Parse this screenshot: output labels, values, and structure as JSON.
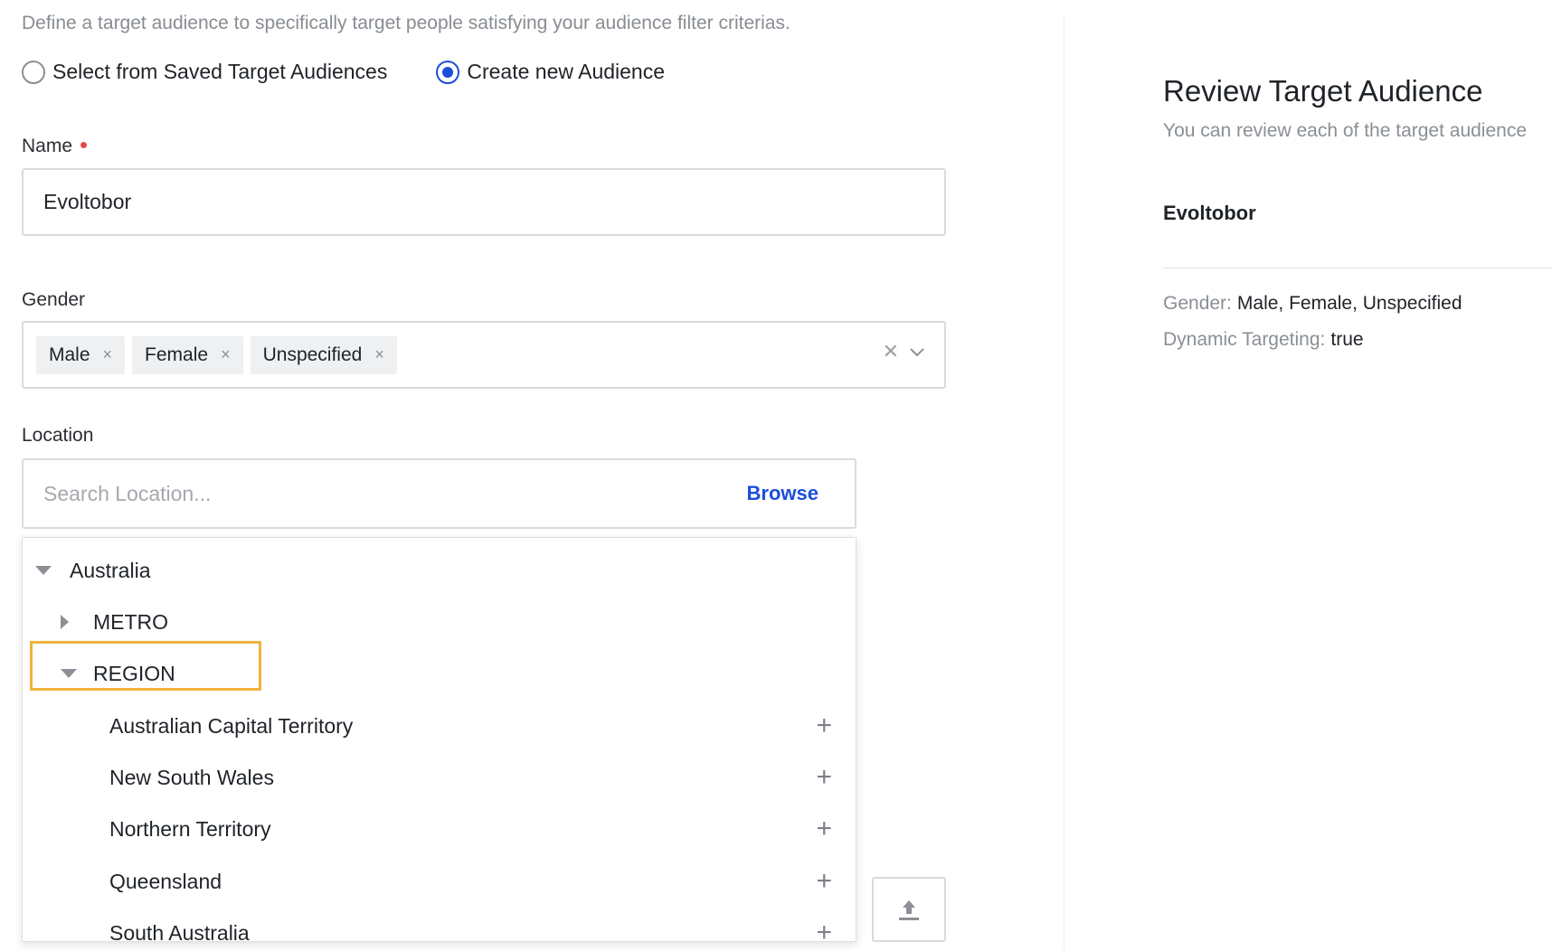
{
  "intro": "Define a target audience to specifically target people satisfying your audience filter criterias.",
  "audience_mode": {
    "options": [
      {
        "label": "Select from Saved Target Audiences",
        "checked": false
      },
      {
        "label": "Create new Audience",
        "checked": true
      }
    ]
  },
  "name_field": {
    "label": "Name",
    "value": "Evoltobor",
    "required": true
  },
  "gender_field": {
    "label": "Gender",
    "chips": [
      "Male",
      "Female",
      "Unspecified"
    ],
    "chip_remove_glyph": "×",
    "clear_glyph": "✕"
  },
  "location_field": {
    "label": "Location",
    "placeholder": "Search Location...",
    "browse_label": "Browse"
  },
  "tree": {
    "country": "Australia",
    "groups": [
      {
        "label": "METRO",
        "expanded": false
      },
      {
        "label": "REGION",
        "expanded": true,
        "highlighted": true
      }
    ],
    "regions": [
      "Australian Capital Territory",
      "New South Wales",
      "Northern Territory",
      "Queensland",
      "South Australia"
    ],
    "add_glyph": "+"
  },
  "review": {
    "title": "Review Target Audience",
    "subtitle": "You can review each of the target audience",
    "audience_name": "Evoltobor",
    "gender_key": "Gender:",
    "gender_value": "Male, Female, Unspecified",
    "dynamic_key": "Dynamic Targeting:",
    "dynamic_value": "true"
  },
  "colors": {
    "accent": "#1c4ed8",
    "highlight": "#f0b33d",
    "required": "#e5484d"
  },
  "icons": {
    "upload": "upload-icon",
    "chevron": "chevron-down-icon",
    "caret": "caret-icon",
    "add": "plus-icon",
    "clear": "clear-icon"
  }
}
